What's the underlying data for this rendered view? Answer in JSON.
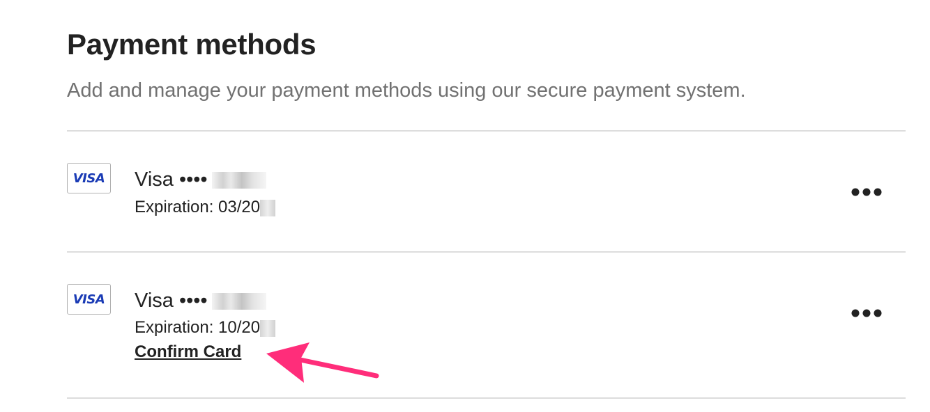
{
  "header": {
    "title": "Payment methods",
    "subtitle": "Add and manage your payment methods using our secure payment system."
  },
  "cards": [
    {
      "brand": "VISA",
      "name": "Visa ••••",
      "expiration": "Expiration: 03/20",
      "more_icon": "ellipsis-horizontal-icon"
    },
    {
      "brand": "VISA",
      "name": "Visa ••••",
      "expiration": "Expiration: 10/20",
      "action_label": "Confirm Card",
      "more_icon": "ellipsis-horizontal-icon"
    }
  ],
  "colors": {
    "text": "#222222",
    "subtext": "#717171",
    "divider": "#dddddd",
    "visa_blue": "#1a3bb5",
    "annotation_arrow": "#ff2d7a"
  }
}
